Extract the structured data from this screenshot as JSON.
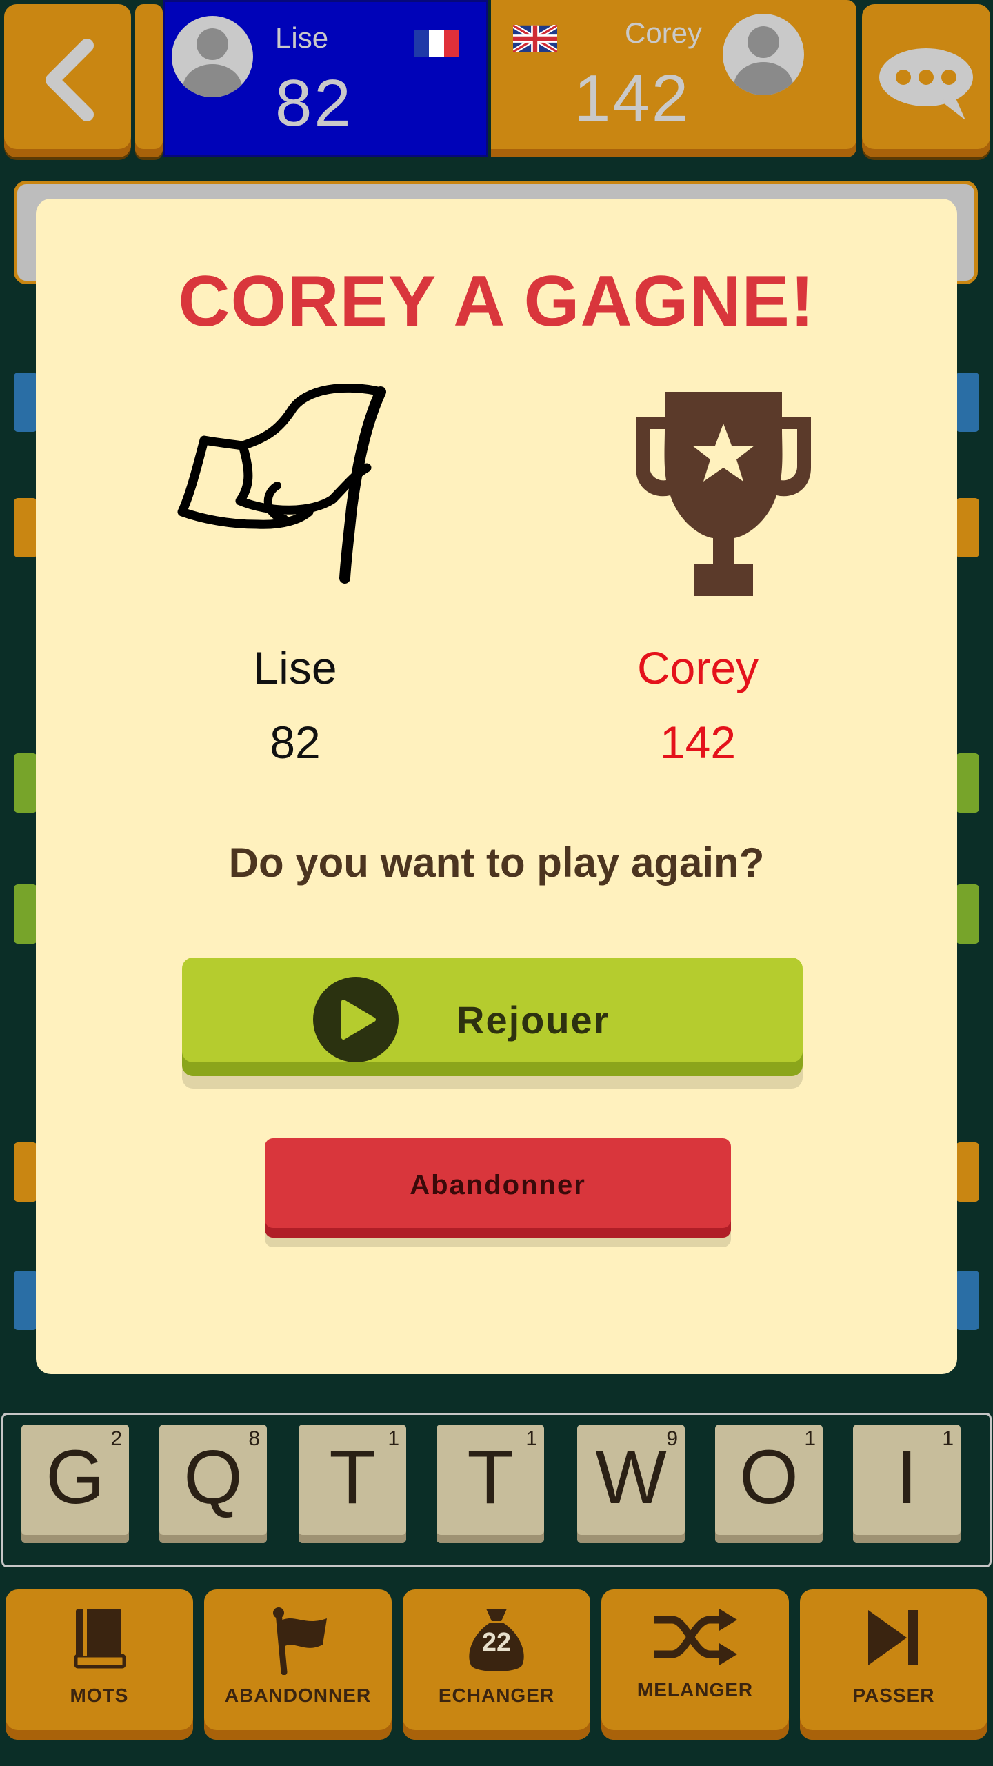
{
  "players": {
    "left": {
      "name": "Lise",
      "score": "82"
    },
    "right": {
      "name": "Corey",
      "score": "142"
    }
  },
  "dialog": {
    "title": "COREY A GAGNE!",
    "loser": {
      "name": "Lise",
      "score": "82"
    },
    "winner": {
      "name": "Corey",
      "score": "142"
    },
    "question": "Do you want to play again?",
    "replay_label": "Rejouer",
    "abandon_label": "Abandonner"
  },
  "rack": [
    {
      "letter": "G",
      "points": "2"
    },
    {
      "letter": "Q",
      "points": "8"
    },
    {
      "letter": "T",
      "points": "1"
    },
    {
      "letter": "T",
      "points": "1"
    },
    {
      "letter": "W",
      "points": "9"
    },
    {
      "letter": "O",
      "points": "1"
    },
    {
      "letter": "I",
      "points": "1"
    }
  ],
  "toolbar": {
    "words_label": "MOTS",
    "abandon_label": "ABANDONNER",
    "exchange_label": "ECHANGER",
    "exchange_count": "22",
    "shuffle_label": "MELANGER",
    "pass_label": "PASSER"
  },
  "icons": {
    "back": "back-arrow-icon",
    "chat": "chat-bubble-icon",
    "loser_flag": "white-flag-icon",
    "winner_trophy": "trophy-icon",
    "play": "play-icon",
    "words": "book-icon",
    "abandon": "flag-icon",
    "exchange": "tile-bag-icon",
    "shuffle": "shuffle-icon",
    "pass": "skip-icon"
  },
  "colors": {
    "title_red": "#d9363c",
    "winner_red": "#e4121b",
    "dialog_bg": "#fff1be",
    "replay_green": "#b5cc2e",
    "abandon_red": "#d9363c",
    "toolbar_orange": "#c98612",
    "active_player_blue": "#0003b8"
  }
}
